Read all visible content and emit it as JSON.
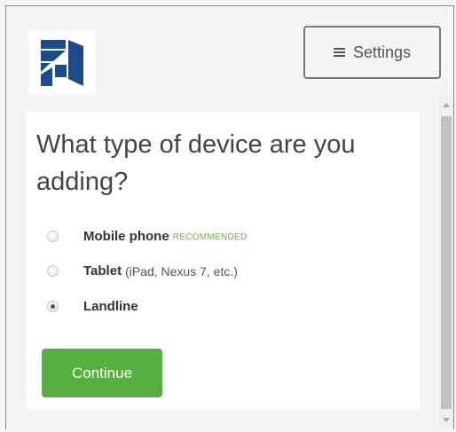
{
  "header": {
    "logo": {
      "icon": "company-logo-icon",
      "color": "#1a4b8c"
    },
    "settings_button": {
      "icon": "menu-icon",
      "label": "Settings"
    }
  },
  "form": {
    "question": "What type of device are you adding?",
    "options": [
      {
        "label": "Mobile phone",
        "note": "RECOMMENDED",
        "hint": "",
        "checked": false
      },
      {
        "label": "Tablet",
        "note": "",
        "hint": "(iPad, Nexus 7, etc.)",
        "checked": false
      },
      {
        "label": "Landline",
        "note": "",
        "hint": "",
        "checked": true
      }
    ],
    "continue_label": "Continue"
  },
  "colors": {
    "primary_button": "#55b03f",
    "recommended_text": "#6cb33f"
  }
}
